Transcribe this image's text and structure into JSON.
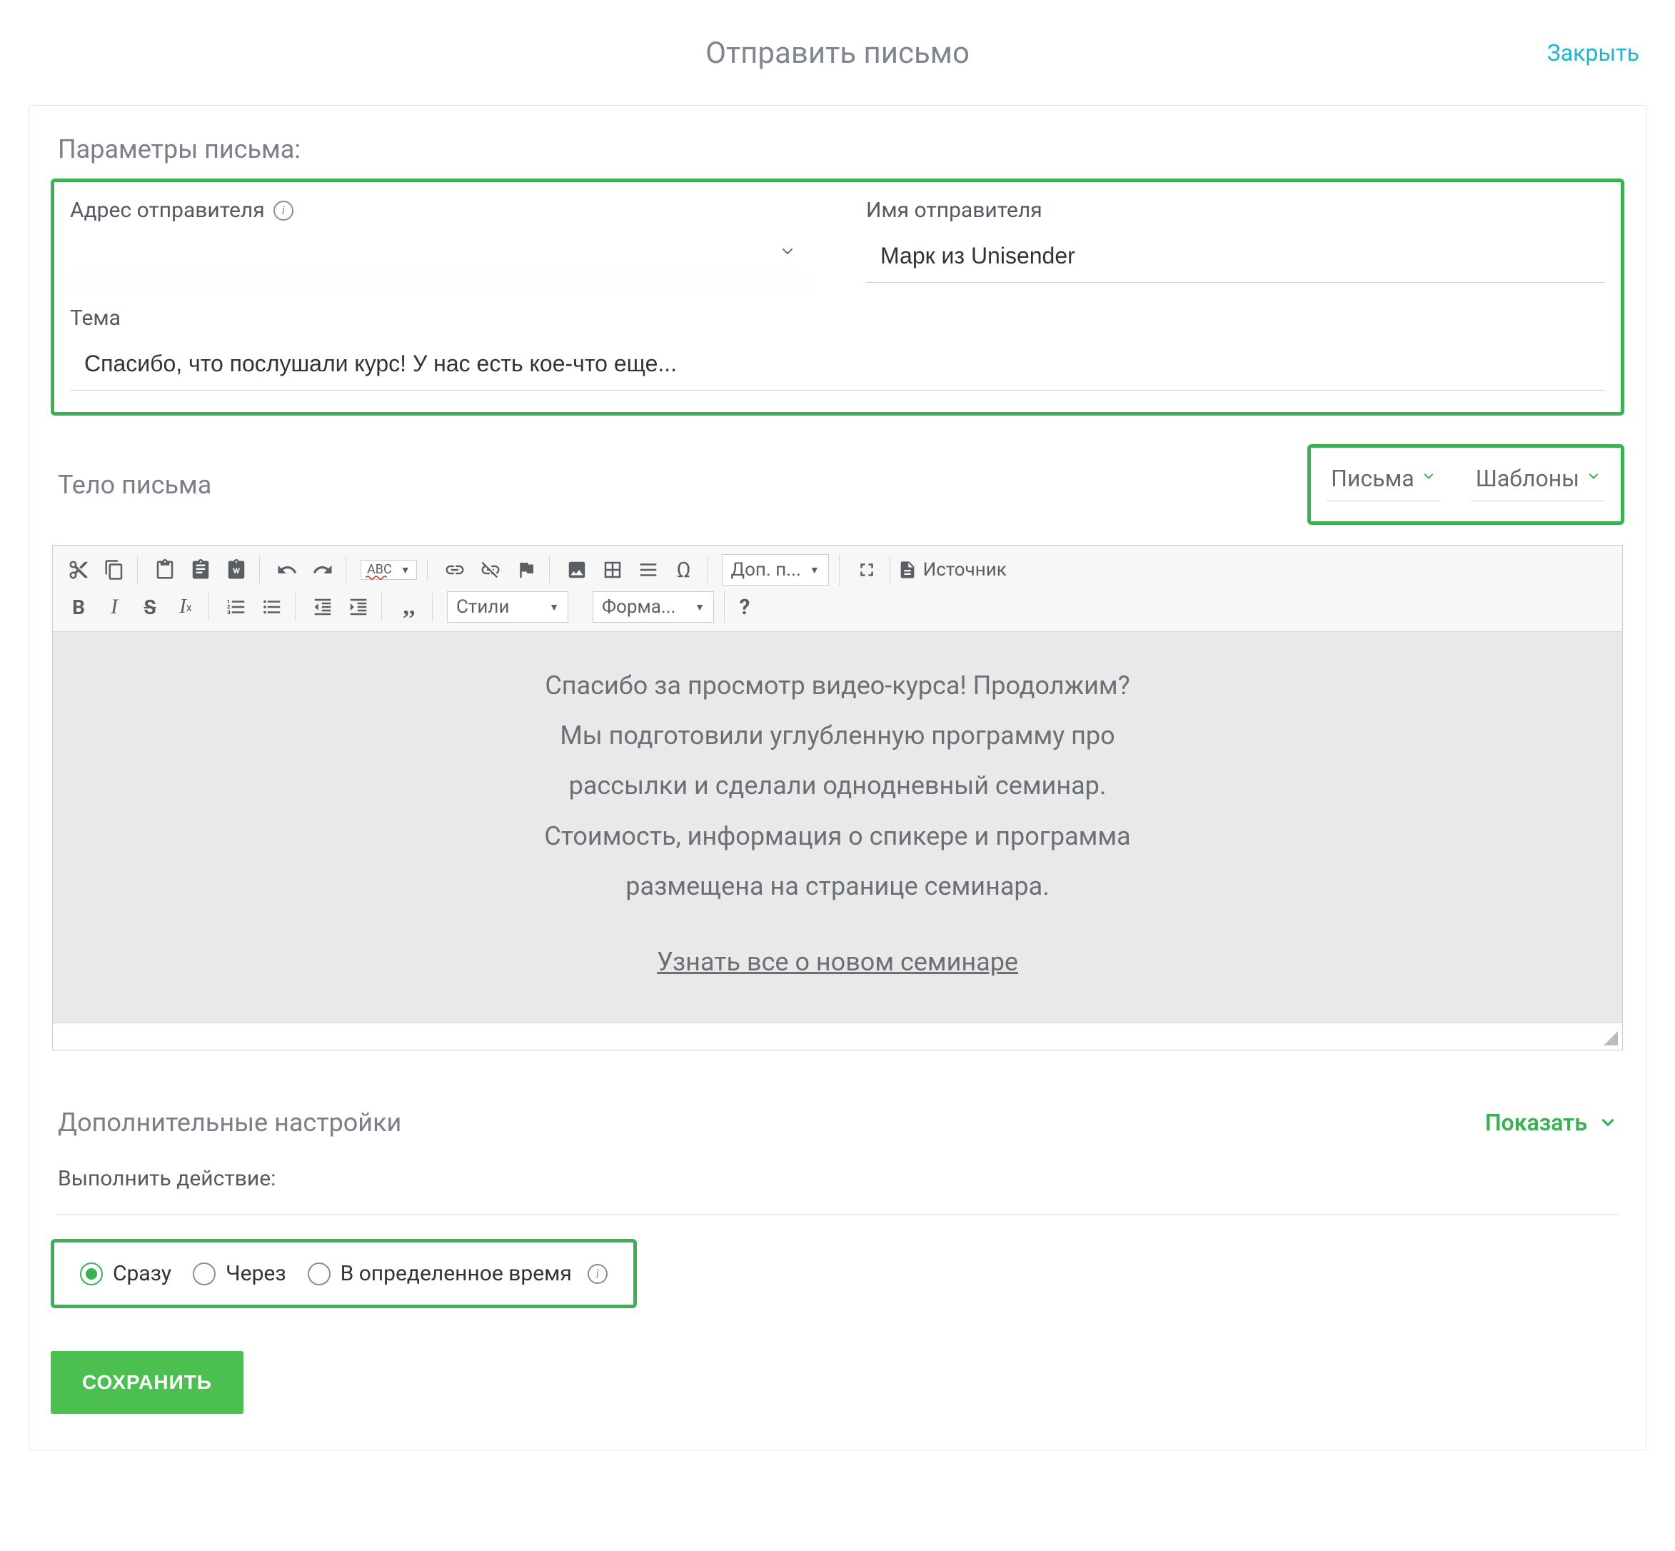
{
  "header": {
    "title": "Отправить письмо",
    "close": "Закрыть"
  },
  "params": {
    "section_title": "Параметры письма:",
    "sender_address_label": "Адрес отправителя",
    "sender_address_value": "",
    "sender_name_label": "Имя отправителя",
    "sender_name_value": "Марк из Unisender",
    "subject_label": "Тема",
    "subject_value": "Спасибо, что послушали курс! У нас есть кое-что еще..."
  },
  "body": {
    "section_title": "Тело письма",
    "picker_letters": "Письма",
    "picker_templates": "Шаблоны",
    "toolbar": {
      "spellcheck": "ABC",
      "more": "Доп. п...",
      "source": "Источник",
      "styles": "Стили",
      "format": "Форма...",
      "help": "?"
    },
    "content_lines": [
      "Спасибо за просмотр видео-курса! Продолжим?",
      "Мы подготовили углубленную программу про",
      "рассылки и сделали однодневный семинар.",
      "Стоимость, информация о спикере и программа",
      "размещена на странице семинара."
    ],
    "content_link": "Узнать все о новом семинаре "
  },
  "extra": {
    "section_title": "Дополнительные настройки",
    "show": "Показать",
    "action_label": "Выполнить действие:",
    "radios": {
      "now": "Сразу",
      "after": "Через",
      "at_time": "В определенное время"
    }
  },
  "save": "СОХРАНИТЬ"
}
